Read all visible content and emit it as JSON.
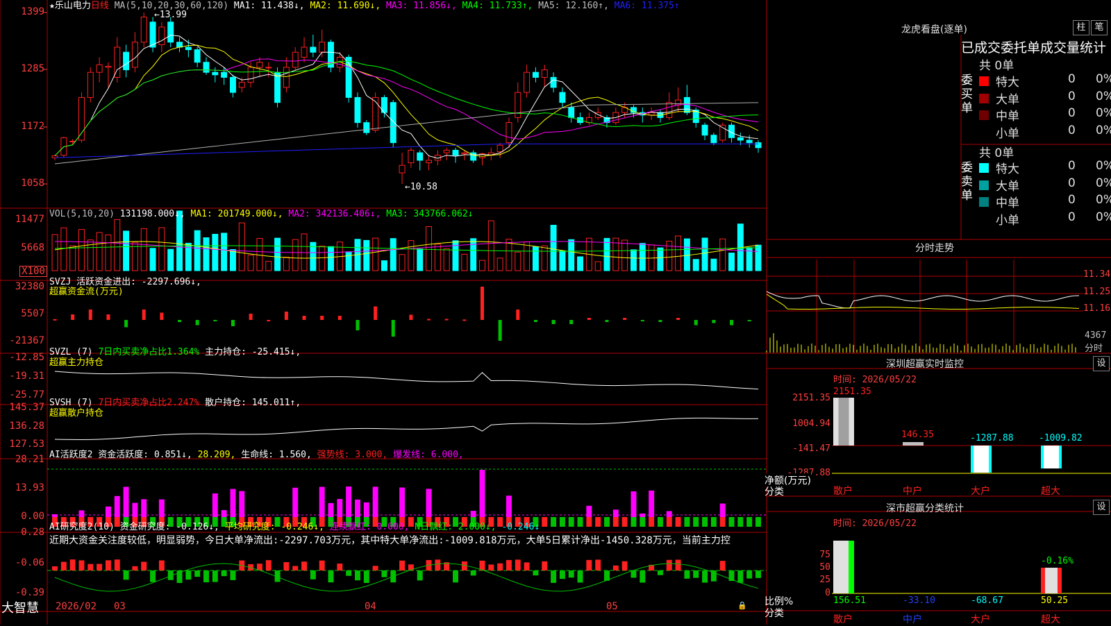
{
  "colors": {
    "up": "#ff2020",
    "down": "#00ffff",
    "grid": "#b00000",
    "axis": "#ff4040",
    "bg": "#000000",
    "ma1": "#ffffff",
    "ma2": "#ffff00",
    "ma3": "#ff00ff",
    "ma4": "#00ff00",
    "ma5": "#b0b0b0",
    "ma6": "#2020ff"
  },
  "header": {
    "star": "★",
    "stock": "乐山电力",
    "period": "日线",
    "ma_params": "MA(5,10,20,30,60,120)",
    "ma1": "MA1: 11.438↓,",
    "ma2": "MA2: 11.690↓,",
    "ma3": "MA3: 11.856↓,",
    "ma4": "MA4: 11.733↑,",
    "ma5": "MA5: 12.160↑,",
    "ma6": "MA6: 11.375↑"
  },
  "price_axis": [
    "1399",
    "1285",
    "1172",
    "1058"
  ],
  "annotations": {
    "high": "13.99",
    "low": "10.58"
  },
  "vol": {
    "title": "VOL(5,10,20)",
    "val": "131198.000↓,",
    "ma1": "MA1: 201749.000↓,",
    "ma2": "MA2: 342136.406↓,",
    "ma3": "MA3: 343766.062↓",
    "axis": [
      "11477",
      "5668"
    ],
    "unit": "X100"
  },
  "svzj": {
    "title": "SVZJ  活跃资金进出: -2297.696↓,",
    "sub": "超赢资金流(万元)",
    "axis": [
      "32380",
      "5507",
      "-21367"
    ]
  },
  "svzl": {
    "title": "SVZL (7)",
    "t2": "7日内买卖净占比1.364%",
    "t3": "主力持仓: -25.415↓,",
    "sub": "超赢主力持仓",
    "axis": [
      "-12.85",
      "-19.31",
      "-25.77"
    ]
  },
  "svsh": {
    "title": "SVSH (7)",
    "t2": "7日内买卖净占比2.247%",
    "t3": "散户持仓: 145.011↑,",
    "sub": "超赢散户持仓",
    "axis": [
      "145.37",
      "136.28",
      "127.53"
    ]
  },
  "ai1": {
    "title": "AI活跃度2 资金活跃度: 0.851↓,",
    "v2": "28.209,",
    "v3": "生命线: 1.560,",
    "v4": "强势线: 3.000,",
    "v5": "爆发线: 6.000,",
    "axis": [
      "28.21",
      "13.93",
      "0.00"
    ]
  },
  "ai2": {
    "title": "AI研究度2(10) 资金研究度: -0.126↓,",
    "v2": "平均研究度: -0.246↓,",
    "v3": "连续飘红: 0.000,",
    "v4": "N日飘红: 2.000↓,",
    "v5": "-0.246↓",
    "desc": "近期大资金关注度较低，明显弱势，今日大单净流出:-2297.703万元，其中特大单净流出:-1009.818万元，大单5日累计净出-1450.328万元，当前主力控",
    "axis": [
      "0.28",
      "-0.06",
      "-0.39"
    ]
  },
  "dates": {
    "d1": "2026/02",
    "d2": "03",
    "d3": "04",
    "d4": "05"
  },
  "brand": "大智慧",
  "lhb": {
    "title": "龙虎看盘(逐单)",
    "btn1": "柱",
    "btn2": "笔",
    "stat_title": "已成交委托单成交量统计",
    "buy": {
      "side": "委买单",
      "total": "共 0单",
      "rows": [
        {
          "n": "特大",
          "v": "0",
          "p": "0%",
          "c": "#ff0000"
        },
        {
          "n": "大单",
          "v": "0",
          "p": "0%",
          "c": "#a00000"
        },
        {
          "n": "中单",
          "v": "0",
          "p": "0%",
          "c": "#700000"
        },
        {
          "n": "小单",
          "v": "0",
          "p": "0%",
          "c": ""
        }
      ]
    },
    "sell": {
      "side": "委卖单",
      "total": "共 0单",
      "rows": [
        {
          "n": "特大",
          "v": "0",
          "p": "0%",
          "c": "#00ffff"
        },
        {
          "n": "大单",
          "v": "0",
          "p": "0%",
          "c": "#00a0a0"
        },
        {
          "n": "中单",
          "v": "0",
          "p": "0%",
          "c": "#008080"
        },
        {
          "n": "小单",
          "v": "0",
          "p": "0%",
          "c": ""
        }
      ]
    }
  },
  "intraday": {
    "title": "分时走势",
    "axis": [
      "11.34",
      "11.25",
      "11.16"
    ],
    "vol": "4367",
    "vol_label": "分时"
  },
  "sz_monitor": {
    "title": "深圳超赢实时监控",
    "btn": "设",
    "time": "时间: 2026/05/22",
    "axis": [
      "2151.35",
      "1004.94",
      "-141.47",
      "-1287.88"
    ],
    "ylabel1": "净额(万元)",
    "ylabel2": "分类",
    "bars": [
      {
        "cat": "散户",
        "v": "2151.35"
      },
      {
        "cat": "中户",
        "v": "146.35"
      },
      {
        "cat": "大户",
        "v": "-1287.88"
      },
      {
        "cat": "超大",
        "v": "-1009.82"
      }
    ]
  },
  "sz_class": {
    "title": "深市超赢分类统计",
    "btn": "设",
    "time": "时间: 2026/05/22",
    "axis": [
      "75",
      "50",
      "25",
      "0"
    ],
    "ylabel1": "比例%",
    "ylabel2": "分类",
    "top_label": "-0.16%",
    "bars": [
      {
        "cat": "散户",
        "v": "156.51"
      },
      {
        "cat": "中户",
        "v": "-33.10"
      },
      {
        "cat": "大户",
        "v": "-68.67"
      },
      {
        "cat": "超大",
        "v": "50.25"
      }
    ]
  },
  "chart_data": {
    "type": "candlestick",
    "title": "乐山电力 日线",
    "candles": [
      [
        11.1,
        11.14,
        11.05,
        11.15
      ],
      [
        11.15,
        11.5,
        11.1,
        11.52
      ],
      [
        11.42,
        11.43,
        11.35,
        11.47
      ],
      [
        11.45,
        12.3,
        11.4,
        12.4
      ],
      [
        12.3,
        12.8,
        12.2,
        12.9
      ],
      [
        12.8,
        12.95,
        12.6,
        13.1
      ],
      [
        12.9,
        12.92,
        12.5,
        13.0
      ],
      [
        12.7,
        13.3,
        12.6,
        13.5
      ],
      [
        13.2,
        12.85,
        12.7,
        13.35
      ],
      [
        12.9,
        13.4,
        12.8,
        13.6
      ],
      [
        13.4,
        13.9,
        13.3,
        13.99
      ],
      [
        13.8,
        13.3,
        13.2,
        13.9
      ],
      [
        13.35,
        13.7,
        13.2,
        13.8
      ],
      [
        13.8,
        13.4,
        13.3,
        13.9
      ],
      [
        13.4,
        13.3,
        13.2,
        13.5
      ],
      [
        13.3,
        13.25,
        13.1,
        13.45
      ],
      [
        13.25,
        13.0,
        12.9,
        13.3
      ],
      [
        13.0,
        12.8,
        12.75,
        13.1
      ],
      [
        12.8,
        12.75,
        12.6,
        12.9
      ],
      [
        12.8,
        12.7,
        12.55,
        12.9
      ],
      [
        12.7,
        12.4,
        12.3,
        12.75
      ],
      [
        12.5,
        12.6,
        12.4,
        12.7
      ],
      [
        12.6,
        12.9,
        12.5,
        13.0
      ],
      [
        12.9,
        13.0,
        12.7,
        13.1
      ],
      [
        12.9,
        12.9,
        12.7,
        13.0
      ],
      [
        12.8,
        12.2,
        12.1,
        12.9
      ],
      [
        12.5,
        12.9,
        12.4,
        13.1
      ],
      [
        12.9,
        13.2,
        12.85,
        13.3
      ],
      [
        13.1,
        13.3,
        13.0,
        13.5
      ],
      [
        13.3,
        13.2,
        13.1,
        13.55
      ],
      [
        13.2,
        13.4,
        13.1,
        13.65
      ],
      [
        13.4,
        12.9,
        12.8,
        13.45
      ],
      [
        12.9,
        13.1,
        12.8,
        13.2
      ],
      [
        13.1,
        12.3,
        12.2,
        13.15
      ],
      [
        12.3,
        11.8,
        11.7,
        12.4
      ],
      [
        11.8,
        11.6,
        11.55,
        11.85
      ],
      [
        11.65,
        12.3,
        11.6,
        12.4
      ],
      [
        12.3,
        12.0,
        11.9,
        12.35
      ],
      [
        12.2,
        11.4,
        11.3,
        12.25
      ],
      [
        10.8,
        10.95,
        10.58,
        11.2
      ],
      [
        11.0,
        11.25,
        10.9,
        11.3
      ],
      [
        11.2,
        11.05,
        10.85,
        11.25
      ],
      [
        11.0,
        11.05,
        10.85,
        11.15
      ],
      [
        11.05,
        11.15,
        10.95,
        11.25
      ],
      [
        11.2,
        11.25,
        11.05,
        11.3
      ],
      [
        11.25,
        11.15,
        11.0,
        11.3
      ],
      [
        11.18,
        11.2,
        11.05,
        11.25
      ],
      [
        11.2,
        11.05,
        11.0,
        11.25
      ],
      [
        11.1,
        11.18,
        10.95,
        11.2
      ],
      [
        11.15,
        11.2,
        11.05,
        11.3
      ],
      [
        11.22,
        11.35,
        11.1,
        11.4
      ],
      [
        11.4,
        11.8,
        11.3,
        11.9
      ],
      [
        11.9,
        12.4,
        11.8,
        12.6
      ],
      [
        12.4,
        12.8,
        12.3,
        12.95
      ],
      [
        12.8,
        12.7,
        12.6,
        12.9
      ],
      [
        12.7,
        12.85,
        12.5,
        12.95
      ],
      [
        12.7,
        12.5,
        12.4,
        12.8
      ],
      [
        12.4,
        12.2,
        12.1,
        12.5
      ],
      [
        12.1,
        11.9,
        11.8,
        12.2
      ],
      [
        11.9,
        11.8,
        11.75,
        12.0
      ],
      [
        11.8,
        11.9,
        11.75,
        12.0
      ],
      [
        11.9,
        12.0,
        11.85,
        12.1
      ],
      [
        11.9,
        11.8,
        11.7,
        11.95
      ],
      [
        11.8,
        12.0,
        11.75,
        12.1
      ],
      [
        12.0,
        12.1,
        11.9,
        12.2
      ],
      [
        12.1,
        12.0,
        11.9,
        12.15
      ],
      [
        12.0,
        11.95,
        11.8,
        12.1
      ],
      [
        11.95,
        12.0,
        11.85,
        12.1
      ],
      [
        12.0,
        11.9,
        11.8,
        12.05
      ],
      [
        11.9,
        12.2,
        11.85,
        12.4
      ],
      [
        12.15,
        12.25,
        12.0,
        12.5
      ],
      [
        12.3,
        12.0,
        11.95,
        12.55
      ],
      [
        12.05,
        11.8,
        11.7,
        12.1
      ],
      [
        11.75,
        11.55,
        11.45,
        11.8
      ],
      [
        11.55,
        11.4,
        11.35,
        11.6
      ],
      [
        11.45,
        11.75,
        11.4,
        11.8
      ],
      [
        11.75,
        11.5,
        11.4,
        11.8
      ],
      [
        11.5,
        11.45,
        11.35,
        11.6
      ],
      [
        11.45,
        11.4,
        11.3,
        11.55
      ],
      [
        11.4,
        11.3,
        11.2,
        11.45
      ]
    ],
    "ma_last": {
      "MA1": 11.438,
      "MA2": 11.69,
      "MA3": 11.856,
      "MA4": 11.733,
      "MA5": 12.16,
      "MA6": 11.375
    }
  }
}
